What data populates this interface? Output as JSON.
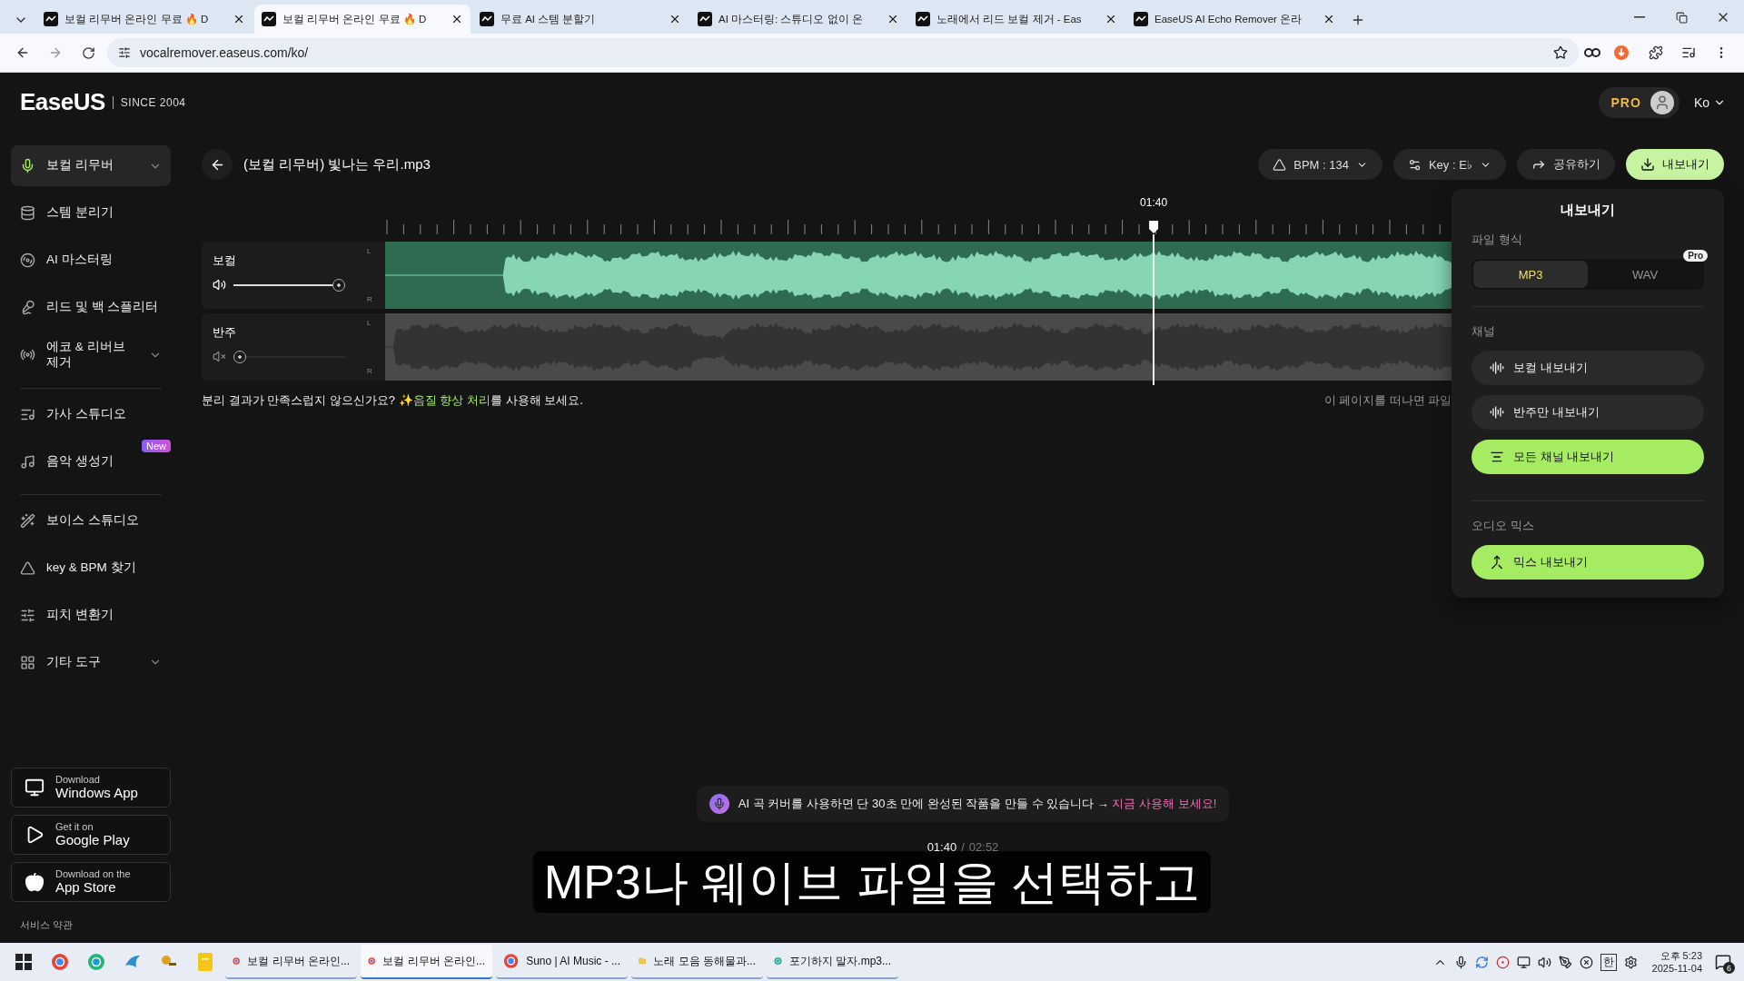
{
  "browser": {
    "tabs": [
      {
        "title": "보컬 리무버 온라인 무료 🔥 D",
        "selected": false
      },
      {
        "title": "보컬 리무버 온라인 무료 🔥 D",
        "selected": true
      },
      {
        "title": "무료 AI 스템 분할기",
        "selected": false
      },
      {
        "title": "AI 마스터링: 스튜디오 없이 온",
        "selected": false
      },
      {
        "title": "노래에서 리드 보컬 제거 - Eas",
        "selected": false
      },
      {
        "title": "EaseUS AI Echo Remover 온라",
        "selected": false
      }
    ],
    "address": "vocalremover.easeus.com/ko/"
  },
  "header": {
    "logo": "EaseUS",
    "since": "SINCE 2004",
    "pro": "PRO",
    "language": "Ko"
  },
  "sidebar": {
    "groups": [
      [
        {
          "label": "보컬 리무버",
          "selected": true,
          "expandable": true
        },
        {
          "label": "스템 분리기",
          "selected": false,
          "expandable": false
        },
        {
          "label": "AI 마스터링",
          "selected": false,
          "expandable": false
        },
        {
          "label": "리드 및 백 스플리터",
          "selected": false,
          "expandable": false
        },
        {
          "label": "에코 & 리버브 제거",
          "selected": false,
          "expandable": true
        }
      ],
      [
        {
          "label": "가사 스튜디오",
          "selected": false,
          "expandable": false
        },
        {
          "label": "음악 생성기",
          "selected": false,
          "expandable": false,
          "badge": "New"
        }
      ],
      [
        {
          "label": "보이스 스튜디오",
          "selected": false,
          "expandable": false
        },
        {
          "label": "key & BPM 찾기",
          "selected": false,
          "expandable": false
        },
        {
          "label": "피치 변환기",
          "selected": false,
          "expandable": false
        },
        {
          "label": "기타 도구",
          "selected": false,
          "expandable": true
        }
      ]
    ],
    "stores": [
      {
        "small": "Download",
        "big": "Windows App"
      },
      {
        "small": "Get it on",
        "big": "Google Play"
      },
      {
        "small": "Download on the",
        "big": "App Store"
      }
    ],
    "footer": "서비스 약관"
  },
  "project": {
    "title": "(보컬 리무버) 빛나는 우리.mp3",
    "bpm": "BPM : 134",
    "key": "Key : E♭",
    "share": "공유하기",
    "export": "내보내기"
  },
  "timeline": {
    "time": "01:40",
    "level": 0.574
  },
  "tracks": [
    {
      "name": "보컬",
      "muted": false,
      "level": 1,
      "channels": [
        "L",
        "R"
      ]
    },
    {
      "name": "반주",
      "muted": true,
      "level": 0,
      "channels": [
        "L",
        "R"
      ]
    }
  ],
  "notice": {
    "prefix": "분리 결과가 만족스럽지 않으신가요?",
    "link": "✨음질 향상 처리",
    "suffix": "를 사용해 보세요.",
    "right": "이 페이지를 떠나면 파일"
  },
  "export_panel": {
    "title": "내보내기",
    "format_label": "파일 형식",
    "formats": [
      {
        "label": "MP3",
        "selected": true
      },
      {
        "label": "WAV",
        "selected": false,
        "badge": "Pro"
      }
    ],
    "channel_label": "채널",
    "channel_buttons": [
      {
        "label": "보컬 내보내기",
        "kind": "wave",
        "primary": false
      },
      {
        "label": "반주만 내보내기",
        "kind": "wave",
        "primary": false
      },
      {
        "label": "모든 채널 내보내기",
        "kind": "list",
        "primary": true
      }
    ],
    "mix_label": "오디오 믹스",
    "mix_button": {
      "label": "믹스 내보내기",
      "kind": "mix",
      "primary": true
    }
  },
  "promo": {
    "text": "AI 곡 커버를 사용하면 단 30초 만에 완성된 작품을 만들 수 있습니다 →",
    "link": "지금 사용해 보세요!"
  },
  "player": {
    "current": "01:40",
    "separator": "/",
    "total": "02:52"
  },
  "caption": "MP3나 웨이브 파일을 선택하고",
  "taskbar": {
    "apps": [
      {
        "label": "보컬 리무버 온라인...",
        "selected": false
      },
      {
        "label": "보컬 리무버 온라인...",
        "selected": true
      },
      {
        "label": "Suno | AI Music - ...",
        "selected": false
      },
      {
        "label": "노래 모음 동해물과...",
        "selected": false
      },
      {
        "label": "포기하지 말자.mp3...",
        "selected": false
      }
    ],
    "ime": "한",
    "time": "오후 5:23",
    "date": "2025-11-04",
    "notifications": "6"
  }
}
